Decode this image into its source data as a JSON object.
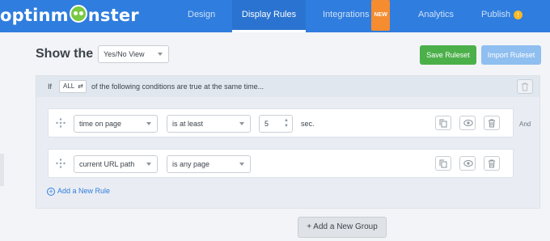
{
  "brand": {
    "logo_text_left": "optinm",
    "logo_text_right": "nster"
  },
  "nav": {
    "tabs": [
      {
        "label": "Design"
      },
      {
        "label": "Display Rules"
      },
      {
        "label": "Integrations",
        "badge": "NEW"
      },
      {
        "label": "Analytics"
      },
      {
        "label": "Publish",
        "badge": "!"
      }
    ]
  },
  "header": {
    "show_label": "Show the",
    "view_select": "Yes/No View",
    "save_ruleset": "Save Ruleset",
    "import_ruleset": "Import Ruleset"
  },
  "group": {
    "if_label": "If",
    "match_select": "ALL",
    "conditions_text": "of the following conditions are true at the same time...",
    "rules": [
      {
        "field": "time on page",
        "operator": "is at least",
        "value": "5",
        "unit": "sec."
      },
      {
        "field": "current URL path",
        "operator": "is any page",
        "value": "",
        "unit": ""
      }
    ],
    "and_label": "And",
    "add_rule": "Add a New Rule"
  },
  "add_group": "+ Add a New Group",
  "colors": {
    "nav_bg": "#2f7dde",
    "save_green": "#4cb04a",
    "import_blue": "#8fbef0",
    "link_blue": "#2f7dde"
  },
  "icons": [
    "drag-handle-icon",
    "copy-icon",
    "eye-icon",
    "trash-icon",
    "plus-circle-icon",
    "swap-icon"
  ]
}
